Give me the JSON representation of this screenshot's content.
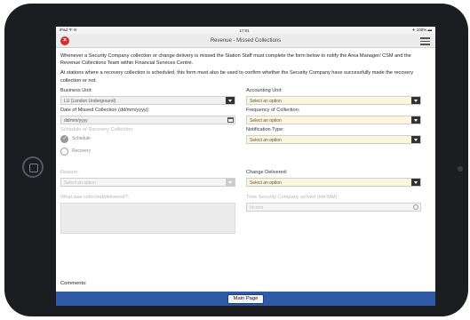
{
  "status_bar": {
    "left": "iPad ᯤ ✉",
    "time": "17:01",
    "right": "✈ 100% ▬"
  },
  "header": {
    "title": "Revenue - Missed Collections"
  },
  "intro": {
    "p1": "Whenever a Security Company collection or change delivery is missed the Station Staff must complete the form below to notify the Area Manager/ CSM and the Revenue Collections Team within Financial Services Centre.",
    "p2": "At stations where a recovery collection is scheduled, this form must also be used to confirm whether the Security Company have successfully made the recovery collection or not."
  },
  "form": {
    "business_unit": {
      "label": "Business Unit:",
      "value": "LU (London Underground)"
    },
    "accounting_unit": {
      "label": "Accounting Unit:",
      "value": "Select an option"
    },
    "date_missed": {
      "label": "Date of Missed Collection (dd/mm/yyyy):",
      "placeholder": "dd/mm/yyyy"
    },
    "frequency": {
      "label": "Frequency of Collection:",
      "value": "Select an option"
    },
    "schedule_or_recovery": {
      "label": "Schedule or Recovery Collection:",
      "options": [
        "Schedule",
        "Recovery"
      ]
    },
    "notification_type": {
      "label": "Notification Type:",
      "value": "Select an option"
    },
    "reason": {
      "label": "Reason:",
      "value": "Select an option"
    },
    "change_delivered": {
      "label": "Change Delivered:",
      "value": "Select an option"
    },
    "what_collected": {
      "label": "What was collected/delivered?:"
    },
    "time_arrived": {
      "label": "Time Security Company arrived (HH:MM):",
      "placeholder": "hh:mm"
    },
    "comments": {
      "label": "Comments:"
    }
  },
  "footer": {
    "main_page_label": "Main Page"
  }
}
